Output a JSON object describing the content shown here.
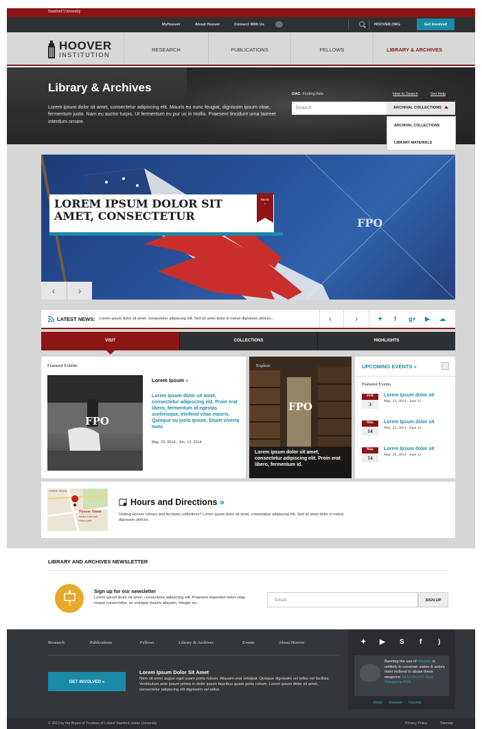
{
  "stanford": {
    "label": "Stanford University"
  },
  "utility": {
    "links": [
      "MyHoover",
      "About Hoover",
      "Connect With Us"
    ],
    "site": "HOOVER.ORG",
    "get_involved": "Get Involved"
  },
  "logo": {
    "word1": "HOOVER",
    "word2": "INSTITUTION"
  },
  "nav": {
    "items": [
      "RESEARCH",
      "PUBLICATIONS",
      "FELLOWS",
      "LIBRARY & ARCHIVES"
    ],
    "active": "LIBRARY & ARCHIVES"
  },
  "hero": {
    "title": "Library & Archives",
    "intro": "Lorem ipsum dolor sit amet, consectetur adipiscing elit. Mauris eu nunc feugiat, dignissim ipsum vitae, fermentum justo. Nam eu auctor turpis. Ut fermentum eu pur us in mollis. Praesent tincidunt urna laoreet interdum ornare.",
    "oac_label": "OAC",
    "oac_text": ": Finding Aids",
    "how_to": "How to Search",
    "get_help": "Get Help",
    "search_placeholder": "Search",
    "selected": "ARCHIVAL COLLECTIONS",
    "options": [
      "ARCHIVAL COLLECTIONS",
      "LIBRARY MATERIALS"
    ]
  },
  "slider": {
    "caption": "LOREM IPSUM DOLOR SIT AMET, CONSECTETUR",
    "read": "READ",
    "read_arrow": "»",
    "fpo": "FPO",
    "prev": "‹",
    "next": "›"
  },
  "news": {
    "label": "LATEST NEWS:",
    "text": "Lorem ipsum dolor sit amet, consectetur adipiscing elit. Sed sit amet dolor in metus dignissim ultrices...",
    "prev": "‹",
    "next": "›",
    "social": [
      "twitter-icon",
      "facebook-icon",
      "google-plus-icon",
      "youtube-icon",
      "soundcloud-icon"
    ]
  },
  "tabs": [
    "VISIT",
    "COLLECTIONS",
    "HIGHLIGHTS"
  ],
  "featured": {
    "title": "Featured Exhibit",
    "fpo": "FPO",
    "heading": "Lorem Ipsum",
    "heading_arrow": "»",
    "description": "Lorem ipsum dolor sit amet, consectetur adipiscing elit. Proin erat libero, fermentum id egestas scelerisque, eleifend vitae mauris. Quisque eu justo ipsum. Etiam viverra nunc",
    "dates": "May. 23, 2014 - Jun. 12, 2014"
  },
  "explore": {
    "title": "Explore",
    "fpo": "FPO",
    "caption": "Lorem ipsum dolor sit amet, consectetur adipiscing elit. Proin erat libero, fermentum id."
  },
  "events": {
    "heading": "UPCOMING EVENTS",
    "heading_arrow": "»",
    "subheading": "Featured Events",
    "items": [
      {
        "month": "FEB",
        "day": "3",
        "title": "Lorem Ipsum dolor sit",
        "date": "May. 23, 2014 - June 12"
      },
      {
        "month": "May",
        "day": "14",
        "title": "Lorem Ipsum dolor sit",
        "date": "May. 23, 2014 - June 12"
      },
      {
        "month": "May",
        "day": "14",
        "title": "Lorem Ipsum dolor sit",
        "date": "May. 23, 2014 - June 12"
      }
    ]
  },
  "hours": {
    "map_label": "Hoover Tower",
    "map_sub": "visitor informati...",
    "map_corner": "Hamm Grove",
    "map_sub2": "Hours.golf",
    "heading": "Hours and Directions",
    "heading_arrow": "»",
    "description": "Visiting Hoover Library and Archives collections? Lorem ipsum dolor sit amet, consectetur adipiscing elit. Sed sit amet dolor in metus dignissim ultrices."
  },
  "newsletter": {
    "title": "LIBRARY AND ARCHIVES NEWSLETTER",
    "heading": "Sign up for our newsletter",
    "description": "Lorem ipsum dolor sit amet, consectetur adipiscing elit. Praesent imperdiet tortor vitae neque consectetur, eu volutpat mauris aliquam. Integer eu.",
    "email_placeholder": "Email",
    "button": "SIGN UP"
  },
  "footer": {
    "nav": [
      "Research",
      "Publications",
      "Fellows",
      "Library & Archives",
      "Events",
      "About Hoover"
    ],
    "get_involved": "GET INVOLVED »",
    "heading": "Lorem Ipsum Dolor Sit Amet",
    "description": "Nam sit amet augue eget quam porta rutrum. Aliquam erat volutpat. Quisque dignissim vel tellus vel facilisis. Vestibulum ante ipsum primis in dolor ipsum faucibus quam porta rutrum. Lorem ipsum dolor sit amet, consectetur adipiscing elit dignissim vel tellus.",
    "social": [
      "twitter-icon",
      "youtube-icon",
      "skype-icon",
      "facebook-icon",
      "rss-icon"
    ],
    "tweet_pre": "Banning the use of ",
    "tweet_tag1": "#drones",
    "tweet_mid": " is unlikely to constrain states & actors most inclined to abuse these weapons: ",
    "tweet_link": "bit.ly/1bur2Vi",
    "tweet_tags": "#war #weapons #US",
    "actions": [
      "Reply",
      "Retweet",
      "Favorite"
    ],
    "copyright": "© 2013 by the Board of Trustees of Leland Stanford Junior University",
    "privacy": "Privacy Policy",
    "sitemap": "Sitemap"
  },
  "colors": {
    "brand_red": "#8c1515",
    "accent_teal": "#1a8aa8",
    "dark": "#2e3134"
  }
}
